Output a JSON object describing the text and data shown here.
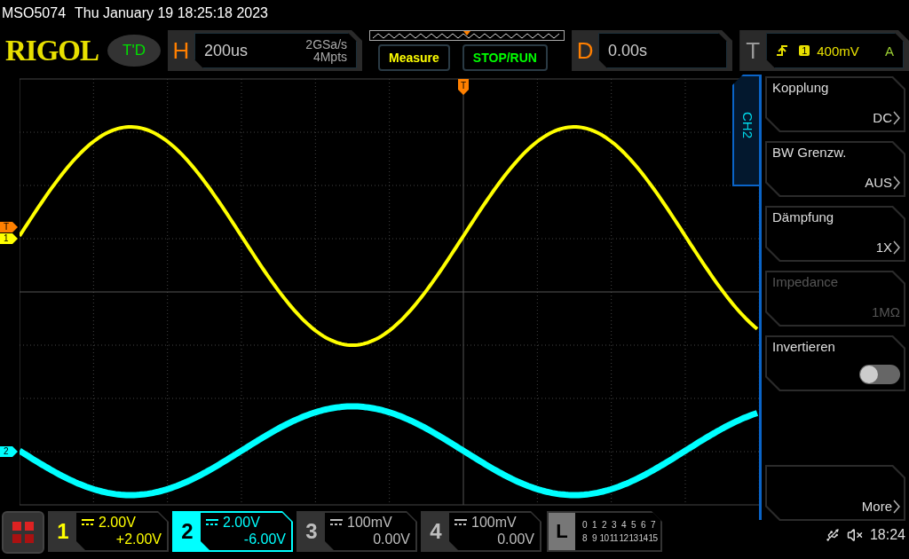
{
  "status_bar": {
    "model": "MSO5074",
    "datetime": "Thu January 19 18:25:18 2023"
  },
  "header": {
    "logo": "RIGOL",
    "mode": "T'D",
    "horizontal": {
      "label": "H",
      "timebase": "200us",
      "sample_rate": "2GSa/s",
      "memory_depth": "4Mpts"
    },
    "buttons": [
      {
        "label": "Measure",
        "color": "#ffff00"
      },
      {
        "label": "STOP/RUN",
        "color": "#00ff00"
      }
    ],
    "delay": {
      "label": "D",
      "value": "0.00s"
    },
    "trigger": {
      "label": "T",
      "source": "1",
      "level": "400mV",
      "mode": "A"
    }
  },
  "display": {
    "trigger_position": "T",
    "markers": [
      {
        "label": "T",
        "color": "#ff8000"
      },
      {
        "label": "1",
        "color": "#ffff00"
      },
      {
        "label": "2",
        "color": "#00ffff"
      }
    ]
  },
  "side_menu": {
    "title": "CH2",
    "items": [
      {
        "kind": "option",
        "label": "Kopplung",
        "value": "DC",
        "disabled": false
      },
      {
        "kind": "option",
        "label": "BW Grenzw.",
        "value": "AUS",
        "disabled": false
      },
      {
        "kind": "option",
        "label": "Dämpfung",
        "value": "1X",
        "disabled": false
      },
      {
        "kind": "option",
        "label": "Impedance",
        "value": "1MΩ",
        "disabled": true
      },
      {
        "kind": "toggle",
        "label": "Invertieren",
        "on": false
      },
      {
        "kind": "spacer"
      },
      {
        "kind": "more",
        "label": "More"
      }
    ]
  },
  "channels": [
    {
      "number": "1",
      "scale": "2.00V",
      "offset": "+2.00V",
      "color": "#ffff00",
      "selected": false,
      "trace": true
    },
    {
      "number": "2",
      "scale": "2.00V",
      "offset": "-6.00V",
      "color": "#00ffff",
      "selected": true,
      "trace": true
    },
    {
      "number": "3",
      "scale": "100mV",
      "offset": "0.00V",
      "color": "#bdbdbd",
      "selected": false,
      "trace": false
    },
    {
      "number": "4",
      "scale": "100mV",
      "offset": "0.00V",
      "color": "#bdbdbd",
      "selected": false,
      "trace": false
    }
  ],
  "logic": {
    "label": "L",
    "rows": [
      [
        "0",
        "1",
        "2",
        "3",
        "4",
        "5",
        "6",
        "7"
      ],
      [
        "8",
        "9",
        "10",
        "11",
        "12",
        "13",
        "14",
        "15"
      ]
    ]
  },
  "system": {
    "time": "18:24"
  }
}
